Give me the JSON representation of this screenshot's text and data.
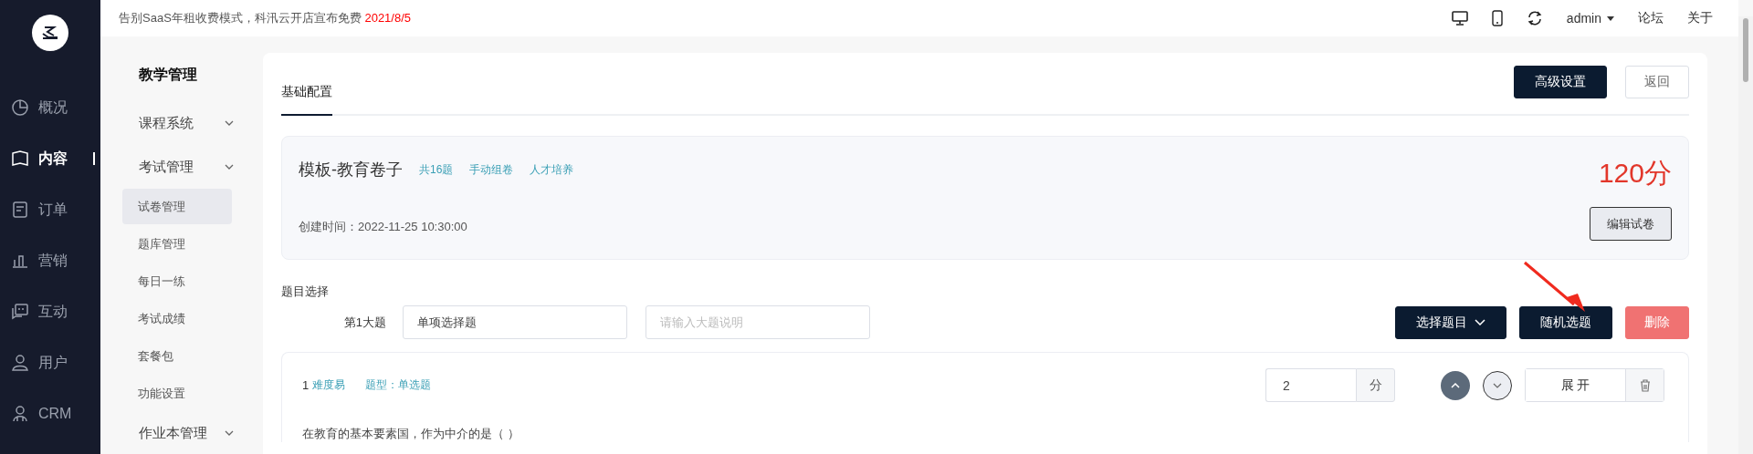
{
  "notice": {
    "text": "告别SaaS年租收费模式，科汛云开店宣布免费",
    "date": "2021/8/5"
  },
  "top_bar": {
    "user": "admin",
    "links": [
      "论坛",
      "关于"
    ]
  },
  "nav": [
    {
      "label": "概况",
      "selected": false
    },
    {
      "label": "内容",
      "selected": true
    },
    {
      "label": "订单",
      "selected": false
    },
    {
      "label": "营销",
      "selected": false
    },
    {
      "label": "互动",
      "selected": false
    },
    {
      "label": "用户",
      "selected": false
    },
    {
      "label": "CRM",
      "selected": false
    }
  ],
  "submenu": {
    "title": "教学管理",
    "groups": [
      {
        "label": "课程系统"
      },
      {
        "label": "考试管理",
        "children": [
          {
            "label": "试卷管理",
            "selected": true
          },
          {
            "label": "题库管理",
            "selected": false
          },
          {
            "label": "每日一练",
            "selected": false
          },
          {
            "label": "考试成绩",
            "selected": false
          },
          {
            "label": "套餐包",
            "selected": false
          },
          {
            "label": "功能设置",
            "selected": false
          }
        ]
      },
      {
        "label": "作业本管理"
      }
    ]
  },
  "tabs": [
    {
      "label": "基础配置",
      "selected": true
    }
  ],
  "header_buttons": [
    {
      "label": "高级设置",
      "kind": "primary"
    },
    {
      "label": "返回",
      "kind": "default"
    }
  ],
  "paper": {
    "title": "模板-教育卷子",
    "tags": [
      "共16题",
      "手动组卷",
      "人才培养"
    ],
    "score": "120分",
    "created": "创建时间：2022-11-25 10:30:00",
    "edit_button": "编辑试卷"
  },
  "section": {
    "title": "题目选择",
    "part_label": "第1大题",
    "name_value": "单项选择题",
    "desc_placeholder": "请输入大题说明",
    "buttons": [
      {
        "label": "选择题目",
        "kind": "dropdown"
      },
      {
        "label": "随机选题",
        "kind": "primary"
      },
      {
        "label": "删除",
        "kind": "danger"
      }
    ]
  },
  "question": {
    "number": "1",
    "difficulty": "难度易",
    "type": "题型：单选题",
    "score_value": "2",
    "score_unit": "分",
    "toggle": "展 开",
    "text": "在教育的基本要素国，作为中介的是（ ）"
  }
}
